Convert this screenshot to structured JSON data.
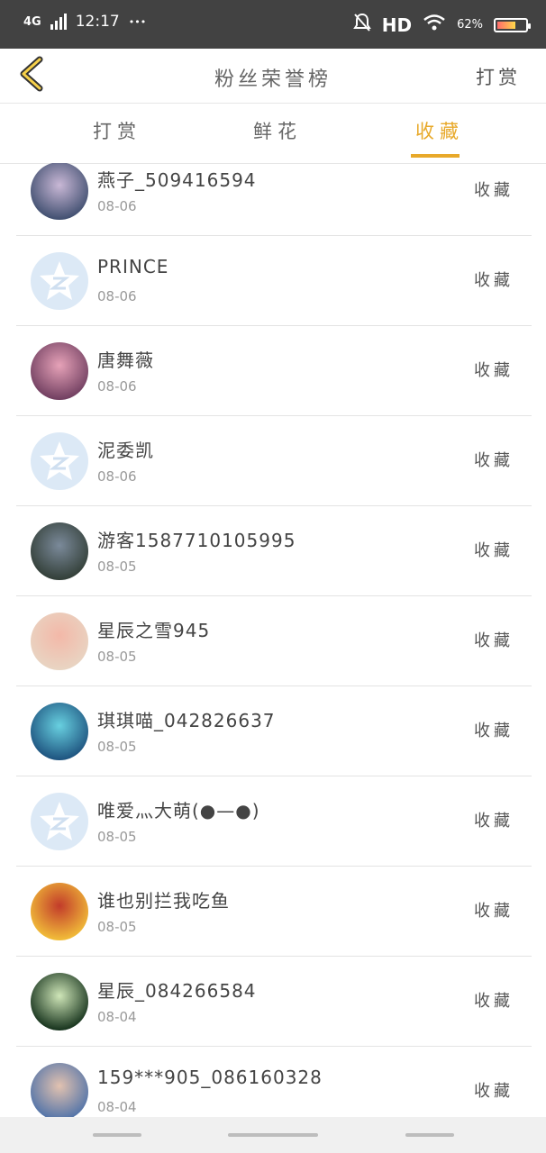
{
  "status_bar": {
    "network": "4G",
    "time": "12:17",
    "dots": "•••",
    "hd": "HD",
    "battery": "62%",
    "battery_level": 0.62
  },
  "header": {
    "title": "粉丝荣誉榜",
    "right_link": "打赏"
  },
  "tabs": [
    {
      "label": "打赏",
      "active": false
    },
    {
      "label": "鲜花",
      "active": false
    },
    {
      "label": "收藏",
      "active": true
    }
  ],
  "colors": {
    "accent": "#e8a92a",
    "status_bar": "#424242",
    "default_avatar": "#dce9f6"
  },
  "rows": [
    {
      "name": "燕子_509416594",
      "date": "08-06",
      "action": "收藏",
      "avatar": "custom"
    },
    {
      "name": "PRINCE",
      "date": "08-06",
      "action": "收藏",
      "avatar": "default"
    },
    {
      "name": "唐舞薇",
      "date": "08-06",
      "action": "收藏",
      "avatar": "custom"
    },
    {
      "name": "泥委凯",
      "date": "08-06",
      "action": "收藏",
      "avatar": "default"
    },
    {
      "name": "游客1587710105995",
      "date": "08-05",
      "action": "收藏",
      "avatar": "custom"
    },
    {
      "name": "星辰之雪945",
      "date": "08-05",
      "action": "收藏",
      "avatar": "custom"
    },
    {
      "name": "琪琪喵_042826637",
      "date": "08-05",
      "action": "收藏",
      "avatar": "custom"
    },
    {
      "name": "唯爱灬大萌(●—●)",
      "date": "08-05",
      "action": "收藏",
      "avatar": "default"
    },
    {
      "name": "谁也别拦我吃鱼",
      "date": "08-05",
      "action": "收藏",
      "avatar": "custom"
    },
    {
      "name": "星辰_084266584",
      "date": "08-04",
      "action": "收藏",
      "avatar": "custom"
    },
    {
      "name": "159***905_086160328",
      "date": "08-04",
      "action": "收藏",
      "avatar": "custom"
    }
  ]
}
